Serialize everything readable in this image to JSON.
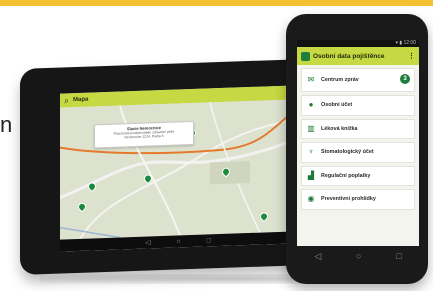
{
  "edge_text": "n",
  "tablet": {
    "search_label": "Mapa",
    "popup": {
      "title": "Slavie Nemocnice",
      "lines": [
        "Pracovisté poskytovatele zdravotní péče",
        "Nemocnice 1234, Praha 5"
      ]
    },
    "nav": {
      "back": "◁",
      "home": "○",
      "recent": "□"
    }
  },
  "phone": {
    "status": "▾ ▮ 12:00",
    "header_title": "Osobní data pojištěnce",
    "menu_icon": "⋮",
    "menu": [
      {
        "label": "Centrum zpráv",
        "icon": "envelope-icon",
        "glyph": "✉",
        "badge": "3"
      },
      {
        "label": "Osobní účet",
        "icon": "person-icon",
        "glyph": "●"
      },
      {
        "label": "Léková knížka",
        "icon": "book-icon",
        "glyph": "▥"
      },
      {
        "label": "Stomatologický účet",
        "icon": "tooth-icon",
        "glyph": "♆"
      },
      {
        "label": "Regulační poplatky",
        "icon": "chart-icon",
        "glyph": "▟"
      },
      {
        "label": "Preventivní prohlídky",
        "icon": "eye-icon",
        "glyph": "◉"
      }
    ],
    "nav": {
      "back": "◁",
      "home": "○",
      "recent": "□"
    }
  },
  "colors": {
    "accent": "#c6d842",
    "brand": "#1d7f3b",
    "stripe": "#f2c230"
  }
}
